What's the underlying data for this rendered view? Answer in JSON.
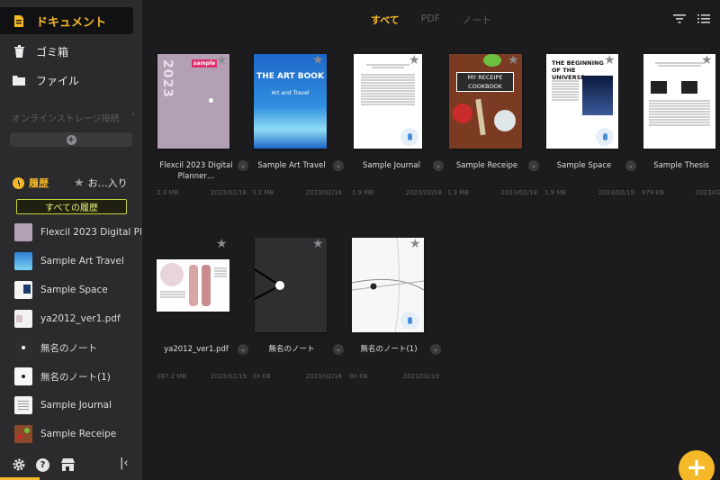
{
  "sidebar": {
    "nav": [
      {
        "label": "ドキュメント",
        "icon": "document-icon"
      },
      {
        "label": "ゴミ箱",
        "icon": "trash-icon"
      },
      {
        "label": "ファイル",
        "icon": "folder-icon"
      }
    ],
    "storage_label": "オンラインストレージ接続",
    "history_tab": "履歴",
    "favorites_tab": "お…入り",
    "all_history_button": "すべての履歴",
    "history": [
      {
        "label": "Flexcil 2023 Digital Pl...",
        "thumb": "planner"
      },
      {
        "label": "Sample Art Travel",
        "thumb": "art"
      },
      {
        "label": "Sample Space",
        "thumb": "space"
      },
      {
        "label": "ya2012_ver1.pdf",
        "thumb": "ya"
      },
      {
        "label": "無名のノート",
        "thumb": "note"
      },
      {
        "label": "無名のノート(1)",
        "thumb": "note1"
      },
      {
        "label": "Sample Journal",
        "thumb": "journal"
      },
      {
        "label": "Sample Receipe",
        "thumb": "receipe"
      }
    ],
    "bottom_icons": [
      "settings-icon",
      "help-icon",
      "store-icon",
      "collapse-sidebar-icon"
    ]
  },
  "main": {
    "tabs": [
      {
        "label": "すべて",
        "active": true
      },
      {
        "label": "PDF",
        "active": false
      },
      {
        "label": "ノート",
        "active": false
      }
    ],
    "documents": [
      {
        "title": "Flexcil 2023 Digital Planner…",
        "size": "2.3 MB",
        "date": "2023/02/18",
        "cover_badge": "sample",
        "cover_text": "2023"
      },
      {
        "title": "Sample Art Travel",
        "size": "3.2 MB",
        "date": "2023/02/18",
        "cover_text": "THE ART BOOK",
        "cover_sub": "Art and Travel"
      },
      {
        "title": "Sample Journal",
        "size": "1.9 MB",
        "date": "2023/02/18"
      },
      {
        "title": "Sample Receipe",
        "size": "1.3 MB",
        "date": "2023/02/18",
        "cover_text": "MY RECEIPE",
        "cover_sub": "COOKBOOK"
      },
      {
        "title": "Sample Space",
        "size": "1.9 MB",
        "date": "2023/02/19",
        "cover_text": "THE BEGINNING OF THE UNIVERSE"
      },
      {
        "title": "Sample Thesis",
        "size": "979 KB",
        "date": "2023/02/18"
      },
      {
        "title": "ya2012_ver1.pdf",
        "size": "187.2 MB",
        "date": "2023/02/19"
      },
      {
        "title": "無名のノート",
        "size": "33 KB",
        "date": "2023/02/18"
      },
      {
        "title": "無名のノート(1)",
        "size": "90 KB",
        "date": "2023/02/19"
      }
    ],
    "fab_label": "+"
  },
  "colors": {
    "accent": "#f5b828",
    "sidebar_bg": "#2b2b2d",
    "main_bg": "#1c1c1e",
    "art_cover": "#2f7fd8",
    "planner_cover": "#b3a0b5"
  }
}
